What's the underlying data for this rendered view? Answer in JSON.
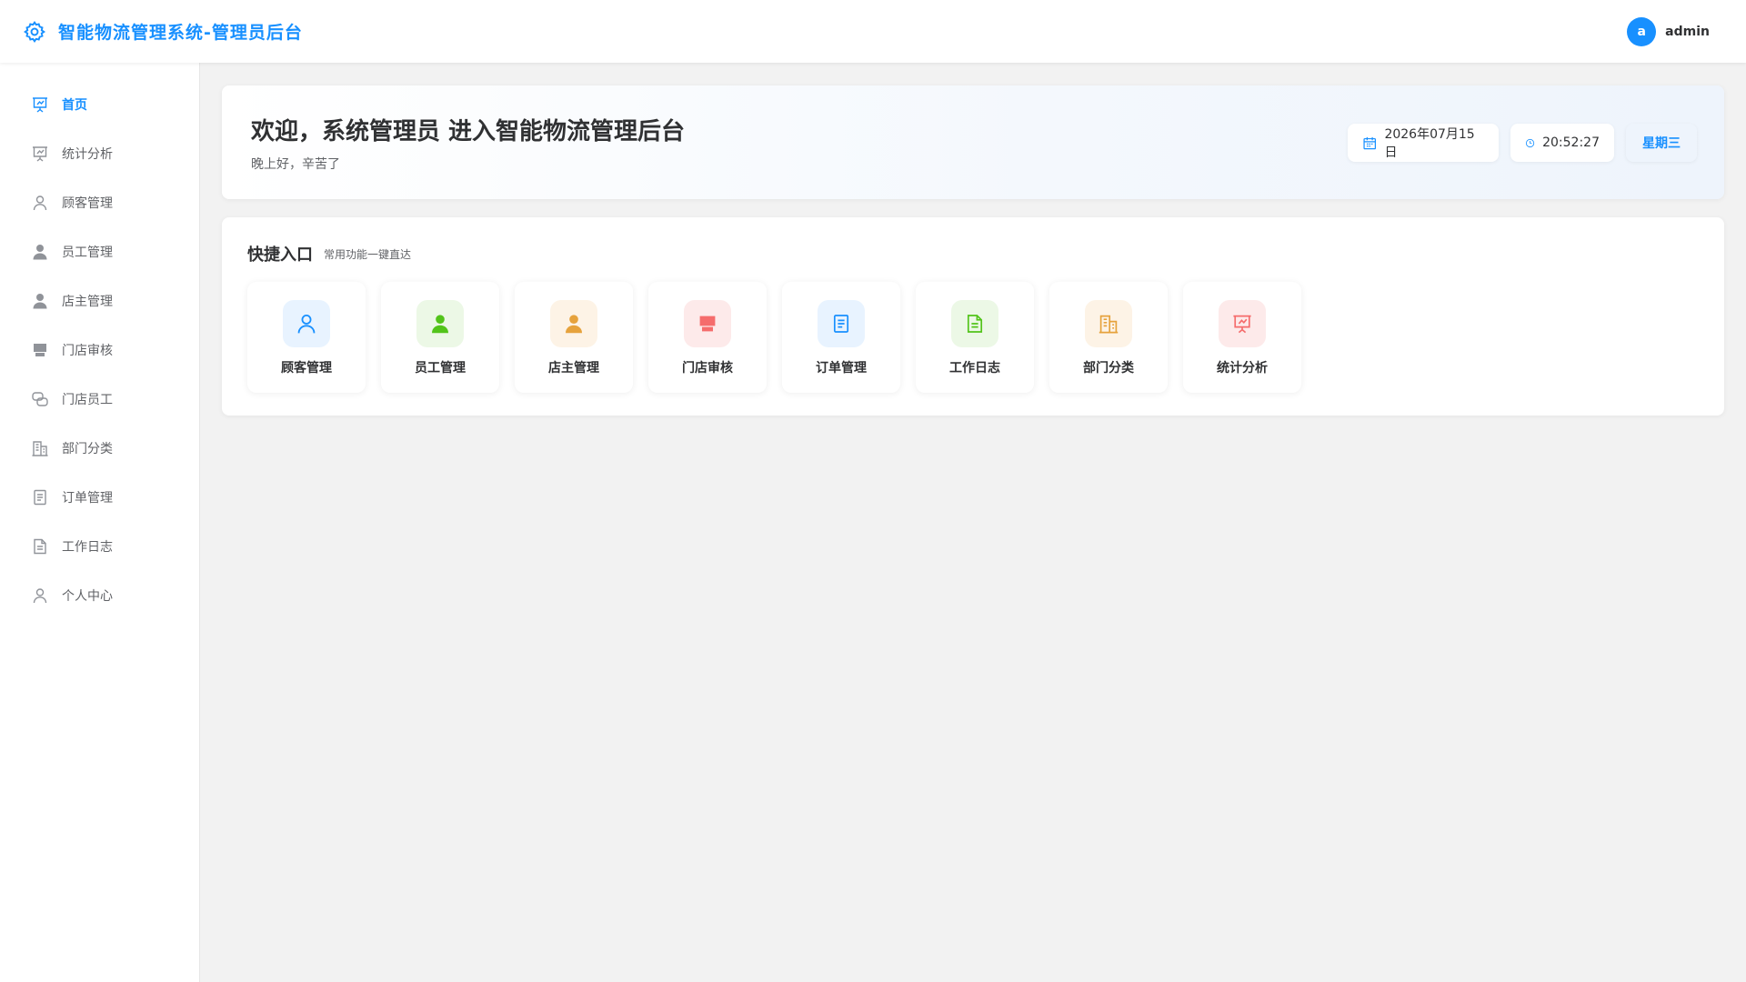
{
  "header": {
    "title": "智能物流管理系统-管理员后台",
    "avatar_letter": "a",
    "username": "admin"
  },
  "sidebar": {
    "items": [
      {
        "label": "首页",
        "icon": "presentation-icon",
        "active": true
      },
      {
        "label": "统计分析",
        "icon": "presentation-icon"
      },
      {
        "label": "顾客管理",
        "icon": "user-outline-icon"
      },
      {
        "label": "员工管理",
        "icon": "user-filled-icon"
      },
      {
        "label": "店主管理",
        "icon": "user-filled-icon"
      },
      {
        "label": "门店审核",
        "icon": "shop-icon"
      },
      {
        "label": "门店员工",
        "icon": "chat-icon"
      },
      {
        "label": "部门分类",
        "icon": "office-building-icon"
      },
      {
        "label": "订单管理",
        "icon": "tickets-icon"
      },
      {
        "label": "工作日志",
        "icon": "document-icon"
      },
      {
        "label": "个人中心",
        "icon": "user-outline-icon"
      }
    ]
  },
  "welcome": {
    "title": "欢迎，系统管理员 进入智能物流管理后台",
    "subtitle": "晚上好，辛苦了",
    "date": "2026年07月15日",
    "time": "20:52:27",
    "weekday": "星期三"
  },
  "quick": {
    "title": "快捷入口",
    "subtitle": "常用功能一键直达",
    "tiles": [
      {
        "label": "顾客管理",
        "icon": "user-outline-icon",
        "color": "#1890ff",
        "bg": "#e8f3ff"
      },
      {
        "label": "员工管理",
        "icon": "user-filled-icon",
        "color": "#52c41a",
        "bg": "#ecf8e6"
      },
      {
        "label": "店主管理",
        "icon": "user-filled-icon",
        "color": "#e6a23c",
        "bg": "#fdf3e6"
      },
      {
        "label": "门店审核",
        "icon": "shop-icon",
        "color": "#f56c6c",
        "bg": "#fdeaea"
      },
      {
        "label": "订单管理",
        "icon": "tickets-icon",
        "color": "#1890ff",
        "bg": "#e8f3ff"
      },
      {
        "label": "工作日志",
        "icon": "document-icon",
        "color": "#52c41a",
        "bg": "#ecf8e6"
      },
      {
        "label": "部门分类",
        "icon": "office-building-icon",
        "color": "#e6a23c",
        "bg": "#fdf3e6"
      },
      {
        "label": "统计分析",
        "icon": "presentation-icon",
        "color": "#f56c6c",
        "bg": "#fdeaea"
      }
    ]
  },
  "colors": {
    "primary": "#1890ff",
    "sidebar_icon": "#909399"
  }
}
